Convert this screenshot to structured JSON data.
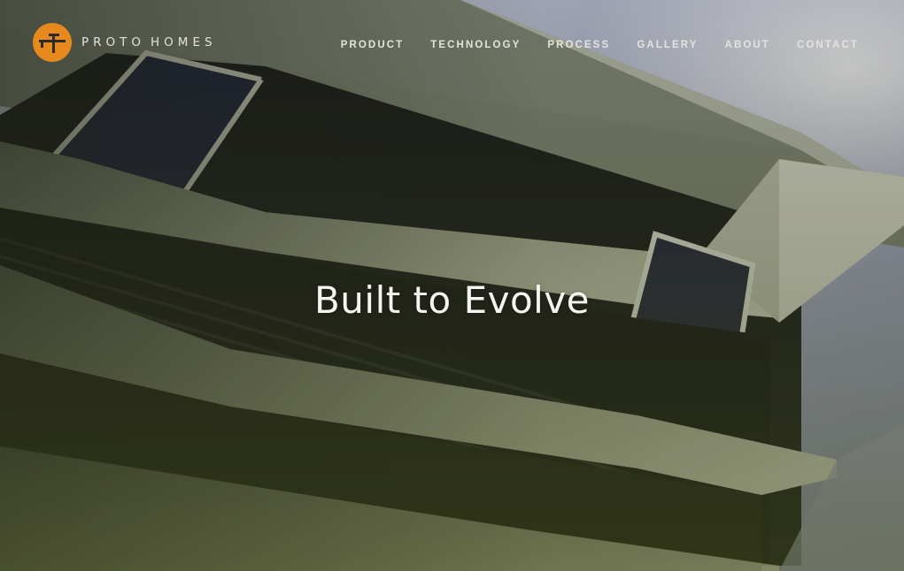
{
  "brand": {
    "name_first": "PROTO",
    "name_second": "HOMES",
    "logo_color": "#e8891e",
    "logo_icon": "proto-homes-logo-icon"
  },
  "nav": {
    "items": [
      {
        "label": "PRODUCT"
      },
      {
        "label": "TECHNOLOGY"
      },
      {
        "label": "PROCESS"
      },
      {
        "label": "GALLERY"
      },
      {
        "label": "ABOUT"
      },
      {
        "label": "CONTACT"
      }
    ]
  },
  "hero": {
    "headline": "Built to Evolve",
    "background": "modern house facade photo, angled low view against sky"
  },
  "colors": {
    "text": "#f4f4f0",
    "accent": "#e8891e",
    "overlay": "#3a3f2e"
  }
}
